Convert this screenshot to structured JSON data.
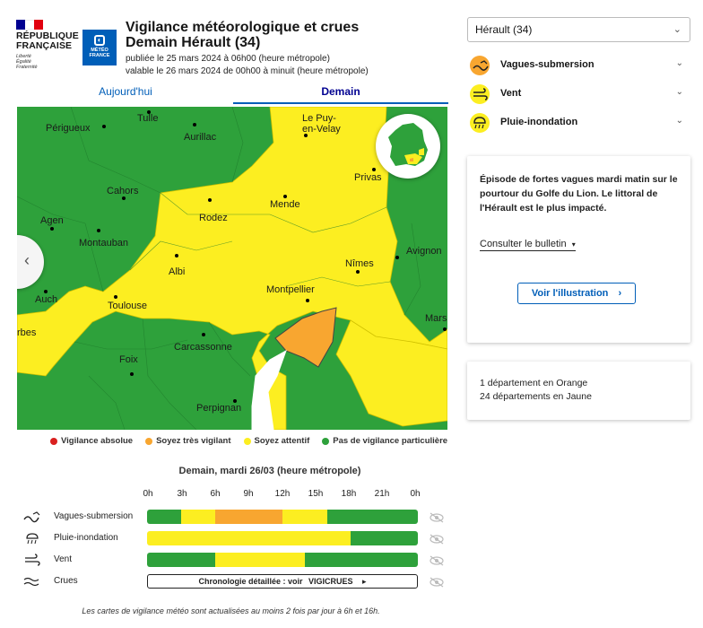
{
  "header": {
    "republique_line1": "RÉPUBLIQUE",
    "republique_line2": "FRANÇAISE",
    "motto_1": "Liberté",
    "motto_2": "Égalité",
    "motto_3": "Fraternité",
    "meteo_logo_line1": "MÉTÉO",
    "meteo_logo_line2": "FRANCE",
    "title_line1": "Vigilance météorologique et crues",
    "title_line2": "Demain Hérault (34)",
    "published": "publiée le 25 mars 2024 à 06h00 (heure métropole)",
    "valid": "valable le 26 mars 2024 de 00h00 à minuit (heure métropole)"
  },
  "tabs": [
    "Aujourd'hui",
    "Demain"
  ],
  "map": {
    "cities": [
      "Périgueux",
      "Tulle",
      "Aurillac",
      "Le Puy-",
      "en-Velay",
      "Privas",
      "Cahors",
      "Rodez",
      "Mende",
      "Agen",
      "Montauban",
      "Albi",
      "Nîmes",
      "Avignon",
      "Montpellier",
      "Auch",
      "Toulouse",
      "Mars",
      "rbes",
      "Carcassonne",
      "Foix",
      "Perpignan"
    ]
  },
  "legend": [
    {
      "label": "Vigilance absolue",
      "color": "#d9201f"
    },
    {
      "label": "Soyez très vigilant",
      "color": "#f8a630"
    },
    {
      "label": "Soyez attentif",
      "color": "#fcee21"
    },
    {
      "label": "Pas de vigilance particulière",
      "color": "#2ea13b"
    }
  ],
  "timeline": {
    "title": "Demain, mardi 26/03 (heure métropole)",
    "hours": [
      "0h",
      "3h",
      "6h",
      "9h",
      "12h",
      "15h",
      "18h",
      "21h",
      "0h"
    ],
    "rows": [
      {
        "label": "Vagues-submersion",
        "icon": "waves-icon",
        "segments": [
          {
            "hours": 3,
            "color": "#2ea13b"
          },
          {
            "hours": 3,
            "color": "#fcee21"
          },
          {
            "hours": 6,
            "color": "#f8a630"
          },
          {
            "hours": 4,
            "color": "#fcee21"
          },
          {
            "hours": 8,
            "color": "#2ea13b"
          }
        ]
      },
      {
        "label": "Pluie-inondation",
        "icon": "rain-icon",
        "segments": [
          {
            "hours": 18,
            "color": "#fcee21"
          },
          {
            "hours": 6,
            "color": "#2ea13b"
          }
        ]
      },
      {
        "label": "Vent",
        "icon": "wind-icon",
        "segments": [
          {
            "hours": 6,
            "color": "#2ea13b"
          },
          {
            "hours": 8,
            "color": "#fcee21"
          },
          {
            "hours": 10,
            "color": "#2ea13b"
          }
        ]
      }
    ],
    "crues_label": "Crues",
    "crues_button": "Chronologie détaillée : voir",
    "crues_link": "VIGICRUES",
    "crues_arrow": "▸",
    "footnote": "Les cartes de vigilance météo sont actualisées au moins 2 fois par jour à 6h et 16h."
  },
  "sidebar": {
    "select_value": "Hérault (34)",
    "accordions": [
      {
        "label": "Vagues-submersion",
        "color": "#f8a630",
        "icon": "waves-icon"
      },
      {
        "label": "Vent",
        "color": "#fcee21",
        "icon": "wind-icon"
      },
      {
        "label": "Pluie-inondation",
        "color": "#fcee21",
        "icon": "rain-icon"
      }
    ],
    "episode_text": "Épisode de fortes vagues mardi matin sur le pourtour du Golfe du Lion. Le littoral de l'Hérault est le plus impacté.",
    "bulletin_link": "Consulter le bulletin",
    "bulletin_caret": "▾",
    "illustration_button": "Voir l'illustration",
    "illustration_chevron": "›",
    "summary_orange": "1 département en Orange",
    "summary_yellow": "24 départements en Jaune"
  }
}
